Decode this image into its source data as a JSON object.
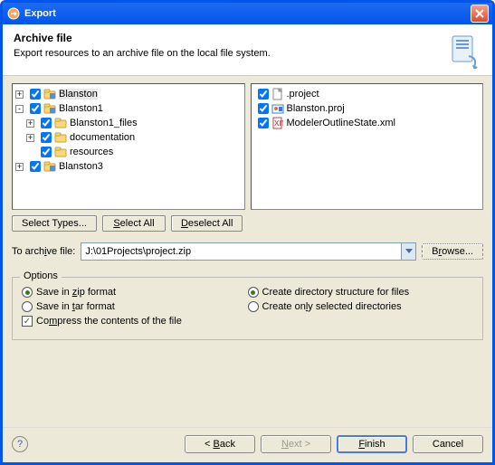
{
  "window": {
    "title": "Export"
  },
  "header": {
    "title": "Archive file",
    "description": "Export resources to an archive file on the local file system."
  },
  "leftTree": [
    {
      "indent": 0,
      "expander": "+",
      "checked": true,
      "icon": "project",
      "label": "Blanston",
      "selected": true
    },
    {
      "indent": 0,
      "expander": "-",
      "checked": true,
      "icon": "project",
      "label": "Blanston1"
    },
    {
      "indent": 1,
      "expander": "+",
      "checked": true,
      "icon": "folder",
      "label": "Blanston1_files"
    },
    {
      "indent": 1,
      "expander": "+",
      "checked": true,
      "icon": "folder",
      "label": "documentation"
    },
    {
      "indent": 1,
      "expander": "",
      "checked": true,
      "icon": "folder",
      "label": "resources"
    },
    {
      "indent": 0,
      "expander": "+",
      "checked": true,
      "icon": "project",
      "label": "Blanston3"
    }
  ],
  "rightTree": [
    {
      "checked": true,
      "icon": "file",
      "label": ".project"
    },
    {
      "checked": true,
      "icon": "proj",
      "label": "Blanston.proj"
    },
    {
      "checked": true,
      "icon": "xml",
      "label": "ModelerOutlineState.xml"
    }
  ],
  "buttons": {
    "selectTypes": "Select Types...",
    "selectAll": "Select All",
    "deselectAll": "Deselect All"
  },
  "archive": {
    "label": "To archive file:",
    "value": "J:\\01Projects\\project.zip",
    "browse": "Browse..."
  },
  "options": {
    "legend": "Options",
    "zip": {
      "label": "Save in zip format",
      "selected": true
    },
    "tar": {
      "label": "Save in tar format",
      "selected": false
    },
    "compress": {
      "label": "Compress the contents of the file",
      "checked": true
    },
    "createDir": {
      "label": "Create directory structure for files",
      "selected": true
    },
    "createSel": {
      "label": "Create only selected directories",
      "selected": false
    }
  },
  "footer": {
    "back": "< Back",
    "next": "Next >",
    "finish": "Finish",
    "cancel": "Cancel"
  }
}
